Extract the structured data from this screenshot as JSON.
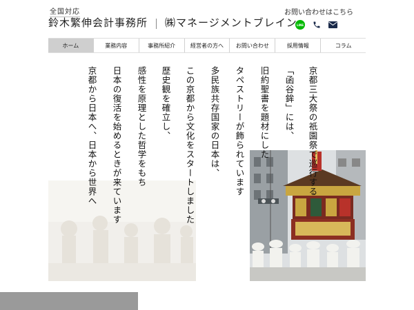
{
  "header": {
    "badge": "全国対応",
    "brand_primary": "鈴木繁伸会計事務所",
    "brand_secondary": "㈱マネージメントブレイン",
    "contact_label": "お問い合わせはこちら",
    "line_icon_text": "LINE"
  },
  "icons": [
    "line-icon",
    "phone-icon",
    "mail-icon"
  ],
  "nav": {
    "items": [
      "ホーム",
      "業務内容",
      "事務所紹介",
      "経営者の方へ",
      "お問い合わせ",
      "採用情報",
      "コラム"
    ],
    "active_index": 0
  },
  "main": {
    "columns": [
      "京都三大祭の祇園祭で巡行する",
      "「函谷鉾」には、",
      "旧約聖書を題材にした",
      "タペストリーが飾られています",
      "多民族共存国家の日本は、",
      "この京都から文化をスタートしました",
      "歴史観を確立し、",
      "感性を原理とした哲学をもち",
      "日本の復活を始めるときが来ています",
      "京都から日本へ、日本から世界へ"
    ]
  },
  "colors": {
    "nav_active": "#cfcfcf",
    "bottom_bar": "#9a9a9a",
    "line_green": "#00b900",
    "float_red": "#b8322a"
  }
}
